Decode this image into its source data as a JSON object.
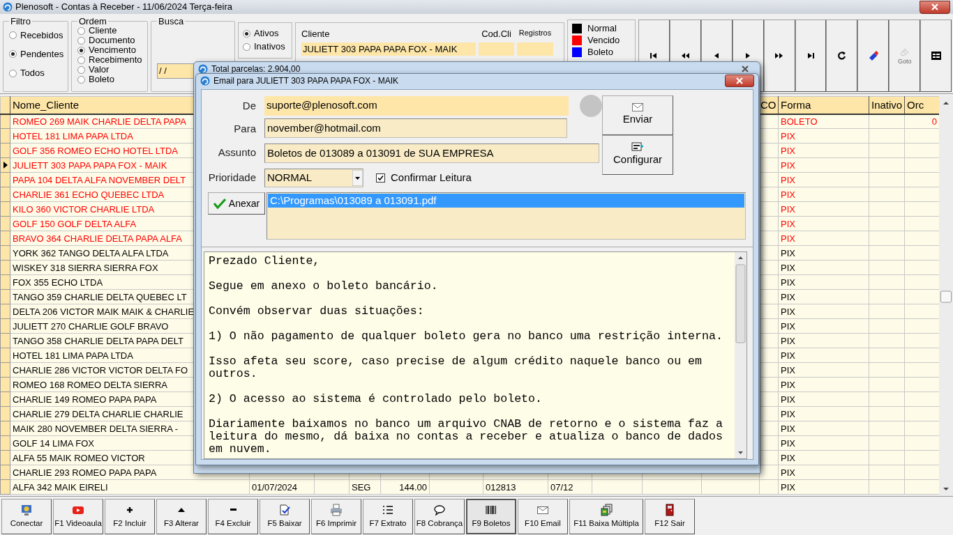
{
  "window": {
    "title": "Plenosoft - Contas à Receber - 11/06/2024 Terça-feira"
  },
  "filter": {
    "title": "Filtro",
    "options": [
      {
        "label": "Recebidos",
        "selected": false
      },
      {
        "label": "Pendentes",
        "selected": true
      },
      {
        "label": "Todos",
        "selected": false
      }
    ]
  },
  "order": {
    "title": "Ordem",
    "options": [
      {
        "label": "Cliente",
        "selected": false
      },
      {
        "label": "Documento",
        "selected": false
      },
      {
        "label": "Vencimento",
        "selected": true
      },
      {
        "label": "Recebimento",
        "selected": false
      },
      {
        "label": "Valor",
        "selected": false
      },
      {
        "label": "Boleto",
        "selected": false
      }
    ]
  },
  "search": {
    "title": "Busca",
    "value": "/ /"
  },
  "status_filter": {
    "options": [
      {
        "label": "Ativos",
        "selected": true
      },
      {
        "label": "Inativos",
        "selected": false
      }
    ]
  },
  "client": {
    "label": "Cliente",
    "value": "JULIETT 303 PAPA PAPA FOX - MAIK",
    "code_label": "Cod.Cli",
    "records_label": "Registros"
  },
  "legend": [
    {
      "label": "Normal",
      "color": "#000000"
    },
    {
      "label": "Vencido",
      "color": "#ff0000"
    },
    {
      "label": "Boleto",
      "color": "#0000ff"
    }
  ],
  "nav_buttons": [
    {
      "kind": "first",
      "disabled": false
    },
    {
      "kind": "prev-page",
      "disabled": false
    },
    {
      "kind": "prev",
      "disabled": false
    },
    {
      "kind": "next",
      "disabled": false
    },
    {
      "kind": "next-page",
      "disabled": false
    },
    {
      "kind": "last",
      "disabled": false
    },
    {
      "kind": "refresh",
      "disabled": false
    },
    {
      "kind": "edit",
      "disabled": false
    },
    {
      "kind": "goto",
      "label": "Goto",
      "disabled": true
    },
    {
      "kind": "form",
      "disabled": false
    }
  ],
  "table": {
    "headers": {
      "name": "Nome_Cliente",
      "co": "CO",
      "forma": "Forma",
      "inativo": "Inativo",
      "orc": "Orc"
    },
    "rows": [
      {
        "name": "ROMEO 269 MAIK CHARLIE DELTA PAPA",
        "forma": "BOLETO",
        "orc": "0",
        "overdue": true,
        "selected": false
      },
      {
        "name": "HOTEL 181 LIMA PAPA LTDA",
        "forma": "PIX",
        "overdue": true,
        "selected": false
      },
      {
        "name": "GOLF 356 ROMEO ECHO HOTEL LTDA",
        "forma": "PIX",
        "overdue": true,
        "selected": false
      },
      {
        "name": "JULIETT 303 PAPA PAPA FOX - MAIK",
        "forma": "PIX",
        "overdue": true,
        "selected": true
      },
      {
        "name": "PAPA 104 DELTA ALFA NOVEMBER DELT",
        "forma": "PIX",
        "overdue": true,
        "selected": false
      },
      {
        "name": "CHARLIE 361 ECHO QUEBEC LTDA",
        "forma": "PIX",
        "overdue": true,
        "selected": false
      },
      {
        "name": "KILO 360 VICTOR CHARLIE LTDA",
        "forma": "PIX",
        "overdue": true,
        "selected": false
      },
      {
        "name": "GOLF 150 GOLF DELTA ALFA",
        "forma": "PIX",
        "overdue": true,
        "selected": false
      },
      {
        "name": "BRAVO 364 CHARLIE DELTA PAPA ALFA",
        "forma": "PIX",
        "overdue": true,
        "selected": false
      },
      {
        "name": "YORK 362 TANGO DELTA ALFA LTDA",
        "forma": "PIX",
        "overdue": false,
        "selected": false
      },
      {
        "name": "WISKEY 318 SIERRA SIERRA FOX",
        "forma": "PIX",
        "overdue": false,
        "selected": false
      },
      {
        "name": "FOX 355 ECHO LTDA",
        "forma": "PIX",
        "overdue": false,
        "selected": false
      },
      {
        "name": "TANGO 359 CHARLIE DELTA QUEBEC LT",
        "forma": "PIX",
        "overdue": false,
        "selected": false
      },
      {
        "name": "DELTA 206 VICTOR MAIK MAIK & CHARLIE",
        "forma": "PIX",
        "overdue": false,
        "selected": false
      },
      {
        "name": "JULIETT 270 CHARLIE GOLF BRAVO",
        "forma": "PIX",
        "overdue": false,
        "selected": false
      },
      {
        "name": "TANGO 358 CHARLIE DELTA PAPA DELT",
        "forma": "PIX",
        "overdue": false,
        "selected": false
      },
      {
        "name": "HOTEL 181 LIMA PAPA LTDA",
        "forma": "PIX",
        "overdue": false,
        "selected": false
      },
      {
        "name": "CHARLIE 286 VICTOR VICTOR DELTA FO",
        "forma": "PIX",
        "overdue": false,
        "selected": false
      },
      {
        "name": "ROMEO 168 ROMEO DELTA SIERRA",
        "forma": "PIX",
        "overdue": false,
        "selected": false
      },
      {
        "name": "CHARLIE 149 ROMEO PAPA PAPA",
        "forma": "PIX",
        "overdue": false,
        "selected": false
      },
      {
        "name": "CHARLIE 279 DELTA CHARLIE CHARLIE",
        "forma": "PIX",
        "overdue": false,
        "selected": false
      },
      {
        "name": "MAIK 280 NOVEMBER DELTA SIERRA -",
        "forma": "PIX",
        "overdue": false,
        "selected": false
      },
      {
        "name": "GOLF 14 LIMA FOX",
        "forma": "PIX",
        "overdue": false,
        "selected": false
      },
      {
        "name": "ALFA 55 MAIK ROMEO VICTOR",
        "forma": "PIX",
        "overdue": false,
        "selected": false
      },
      {
        "name": "CHARLIE 293 ROMEO PAPA PAPA",
        "forma": "PIX",
        "overdue": false,
        "selected": false
      },
      {
        "name": "ALFA 342 MAIK EIRELI",
        "column_2": "01/07/2024",
        "column_4": "SEG",
        "column_5": "144.00",
        "column_7": "012813",
        "column_8": "07/12",
        "forma": "PIX",
        "overdue": false,
        "selected": false
      }
    ]
  },
  "back_window": {
    "title": "Total parcelas: 2.904,00"
  },
  "email_dialog": {
    "title": "Email para JULIETT 303 PAPA PAPA FOX - MAIK",
    "from_label": "De",
    "from": "suporte@plenosoft.com",
    "to_label": "Para",
    "to": "november@hotmail.com",
    "subject_label": "Assunto",
    "subject": "Boletos de 013089 a 013091 de SUA EMPRESA",
    "priority_label": "Prioridade",
    "priority": "NORMAL",
    "read_receipt": {
      "label": "Confirmar Leitura",
      "checked": true
    },
    "send_button": "Enviar",
    "config_button": "Configurar",
    "attach_button": "Anexar",
    "attachments": [
      {
        "name": "C:\\Programas\\013089 a 013091.pdf",
        "selected": true
      }
    ],
    "message": "Prezado Cliente,\n\nSegue em anexo o boleto bancário.\n\nConvém observar duas situações:\n\n1) O não pagamento de qualquer boleto gera no banco uma restrição interna.\n\nIsso afeta seu score, caso precise de algum crédito naquele banco ou em\noutros.\n\n2) O acesso ao sistema é controlado pelo boleto.\n\nDiariamente baixamos no banco um arquivo CNAB de retorno e o sistema faz a\nleitura do mesmo, dá baixa no contas a receber e atualiza o banco de dados\nem nuvem."
  },
  "toolbar": [
    {
      "kind": "connect",
      "label": "Conectar",
      "selected": false
    },
    {
      "kind": "video",
      "label": "F1 Videoaula",
      "selected": false
    },
    {
      "kind": "plus",
      "label": "F2 Incluir",
      "selected": false
    },
    {
      "kind": "up",
      "label": "F3 Alterar",
      "selected": false
    },
    {
      "kind": "minus",
      "label": "F4 Excluir",
      "selected": false
    },
    {
      "kind": "check",
      "label": "F5 Baixar",
      "selected": false
    },
    {
      "kind": "print",
      "label": "F6 Imprimir",
      "selected": false
    },
    {
      "kind": "list",
      "label": "F7 Extrato",
      "selected": false
    },
    {
      "kind": "chat",
      "label": "F8 Cobrança",
      "selected": false
    },
    {
      "kind": "barcode",
      "label": "F9 Boletos",
      "selected": true
    },
    {
      "kind": "mail",
      "label": "F10 Email",
      "selected": false
    },
    {
      "kind": "stack",
      "label": "F11 Baixa Múltipla",
      "selected": false
    },
    {
      "kind": "door",
      "label": "F12 Sair",
      "selected": false
    }
  ]
}
